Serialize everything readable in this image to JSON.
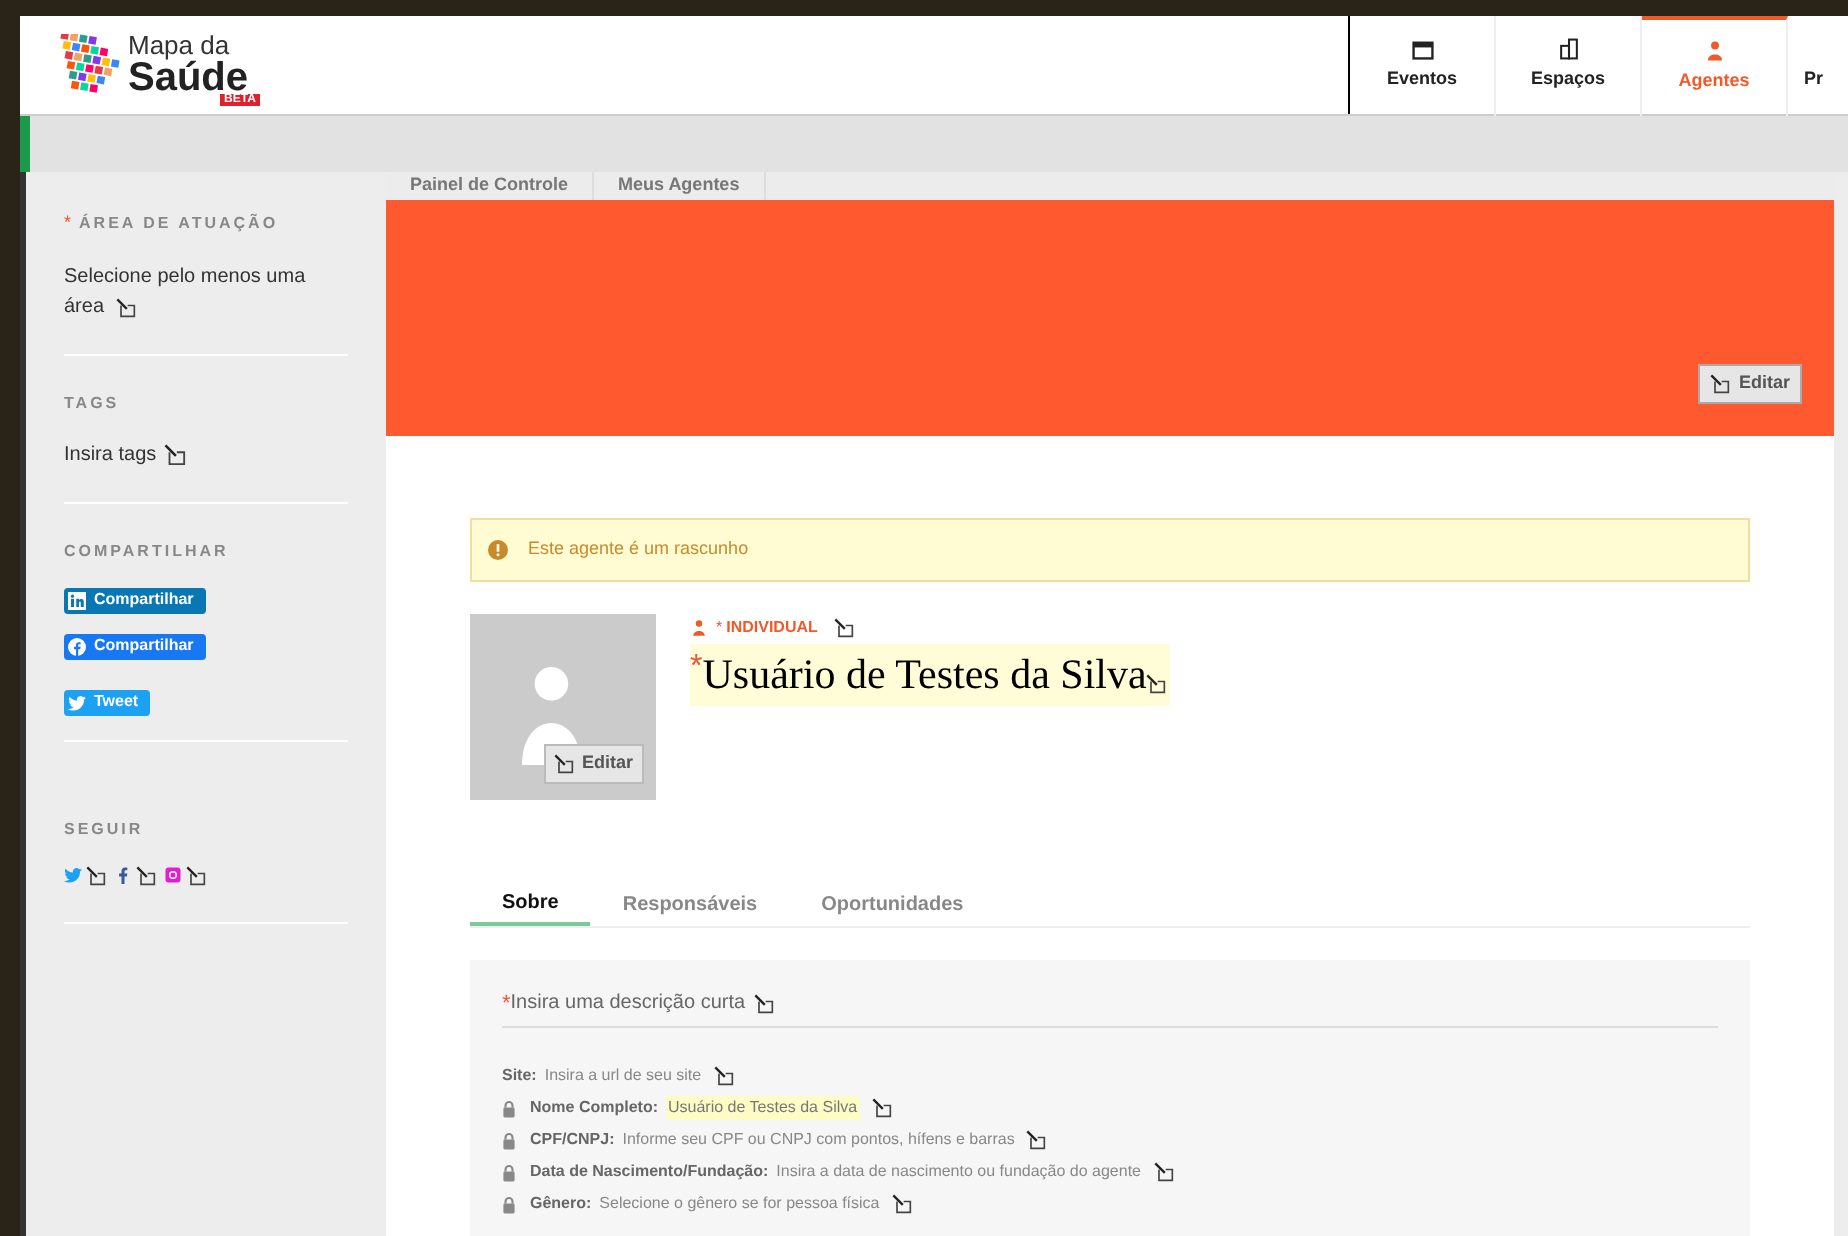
{
  "logo": {
    "line1": "Mapa da",
    "line2": "Saúde",
    "badge": "BETA"
  },
  "nav": [
    {
      "label": "Eventos",
      "kind": "calendar",
      "selected": false
    },
    {
      "label": "Espaços",
      "kind": "building",
      "selected": false
    },
    {
      "label": "Agentes",
      "kind": "person",
      "selected": true
    },
    {
      "label": "Pr",
      "kind": "plain",
      "selected": false
    }
  ],
  "breadcrumbs": [
    "Painel de Controle",
    "Meus Agentes"
  ],
  "sidebar": {
    "area": {
      "title": "ÁREA DE ATUAÇÃO",
      "marker": "*",
      "text": "Selecione pelo menos uma área"
    },
    "tags": {
      "title": "TAGS",
      "text": "Insira tags"
    },
    "share": {
      "title": "COMPARTILHAR",
      "buttons": [
        {
          "kind": "linkedin",
          "label": "Compartilhar"
        },
        {
          "kind": "facebook",
          "label": "Compartilhar"
        },
        {
          "kind": "twitter",
          "label": "Tweet"
        }
      ]
    },
    "follow": {
      "title": "SEGUIR",
      "networks": [
        {
          "kind": "twitter"
        },
        {
          "kind": "facebook"
        },
        {
          "kind": "instagram"
        }
      ]
    }
  },
  "cover": {
    "edit_label": "Editar"
  },
  "alert": "Este agente é um rascunho",
  "profile": {
    "avatar_edit_label": "Editar",
    "type_marker": "*",
    "type": "INDIVIDUAL",
    "name_marker": "*",
    "name": "Usuário de Testes da Silva"
  },
  "tabs": [
    {
      "label": "Sobre",
      "selected": true
    },
    {
      "label": "Responsáveis",
      "selected": false
    },
    {
      "label": "Oportunidades",
      "selected": false
    }
  ],
  "description_marker": "*",
  "description_placeholder": "Insira uma descrição curta",
  "fields": [
    {
      "label": "Site:",
      "value": "Insira a url de seu site",
      "locked": false,
      "filled": false
    },
    {
      "label": "Nome Completo:",
      "value": "Usuário de Testes da Silva",
      "locked": true,
      "filled": true
    },
    {
      "label": "CPF/CNPJ:",
      "value": "Informe seu CPF ou CNPJ com pontos, hífens e barras",
      "locked": true,
      "filled": false
    },
    {
      "label": "Data de Nascimento/Fundação:",
      "value": "Insira a data de nascimento ou fundação do agente",
      "locked": true,
      "filled": false
    },
    {
      "label": "Gênero:",
      "value": "Selecione o gênero se for pessoa física",
      "locked": true,
      "filled": false
    }
  ]
}
